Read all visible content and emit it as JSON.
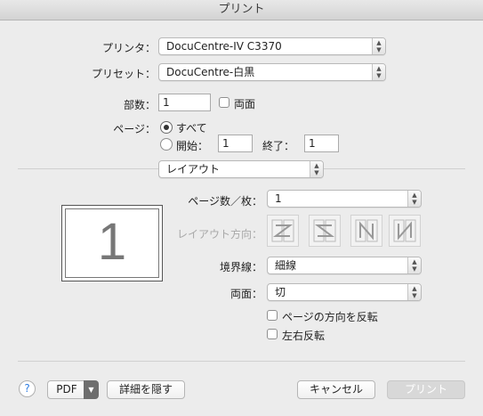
{
  "window": {
    "title": "プリント"
  },
  "printer": {
    "label": "プリンタ：",
    "value": "DocuCentre-IV C3370"
  },
  "preset": {
    "label": "プリセット：",
    "value": "DocuCentre-白黒"
  },
  "copies": {
    "label": "部数：",
    "value": "1",
    "duplex_label": "両面"
  },
  "pages": {
    "label": "ページ：",
    "all_label": "すべて",
    "range_from_label": "開始：",
    "range_from_value": "1",
    "range_to_label": "終了：",
    "range_to_value": "1",
    "selected": "all"
  },
  "section": {
    "value": "レイアウト"
  },
  "preview": {
    "page_number": "1"
  },
  "layout": {
    "pages_per_sheet_label": "ページ数／枚：",
    "pages_per_sheet_value": "1",
    "direction_label": "レイアウト方向：",
    "direction_options": [
      "z-left-right",
      "z-right-left",
      "n-down",
      "n-down-reverse"
    ],
    "border_label": "境界線：",
    "border_value": "細線",
    "two_sided_label": "両面：",
    "two_sided_value": "切",
    "reverse_orientation_label": "ページの方向を反転",
    "flip_horizontal_label": "左右反転"
  },
  "footer": {
    "help_glyph": "?",
    "pdf_label": "PDF",
    "hide_details_label": "詳細を隠す",
    "cancel_label": "キャンセル",
    "print_label": "プリント"
  },
  "colors": {
    "accent": "#2f7de1",
    "window_bg": "#ececec"
  }
}
